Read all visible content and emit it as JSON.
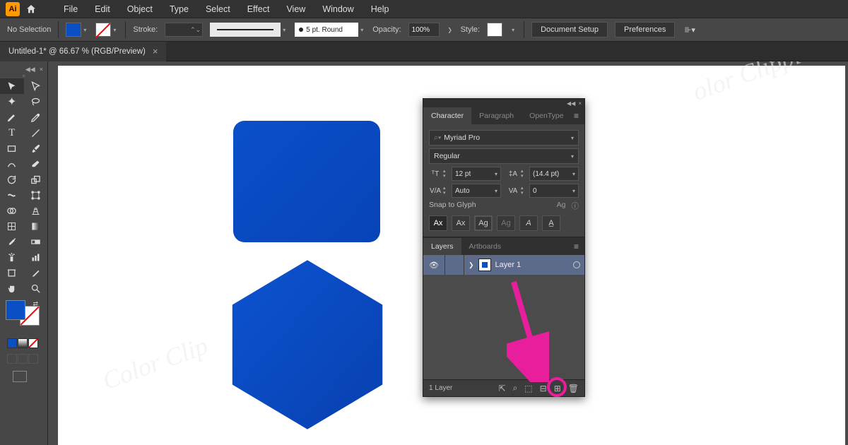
{
  "menu": {
    "items": [
      "File",
      "Edit",
      "Object",
      "Type",
      "Select",
      "Effect",
      "View",
      "Window",
      "Help"
    ]
  },
  "controlbar": {
    "selection_label": "No Selection",
    "stroke_label": "Stroke:",
    "brush_label": "5 pt. Round",
    "opacity_label": "Opacity:",
    "opacity_value": "100%",
    "style_label": "Style:",
    "document_setup": "Document Setup",
    "preferences": "Preferences"
  },
  "tab": {
    "title": "Untitled-1* @ 66.67 % (RGB/Preview)"
  },
  "character_panel": {
    "tabs": [
      "Character",
      "Paragraph",
      "OpenType"
    ],
    "active_tab": 0,
    "font_family": "Myriad Pro",
    "font_style": "Regular",
    "size": "12 pt",
    "leading": "(14.4 pt)",
    "kerning": "Auto",
    "tracking": "0",
    "snap_label": "Snap to Glyph"
  },
  "layers_panel": {
    "tabs": [
      "Layers",
      "Artboards"
    ],
    "active_tab": 0,
    "layer_name": "Layer 1",
    "count_label": "1 Layer"
  },
  "colors": {
    "fill": "#0b4fc4",
    "highlight": "#e91e9c"
  }
}
